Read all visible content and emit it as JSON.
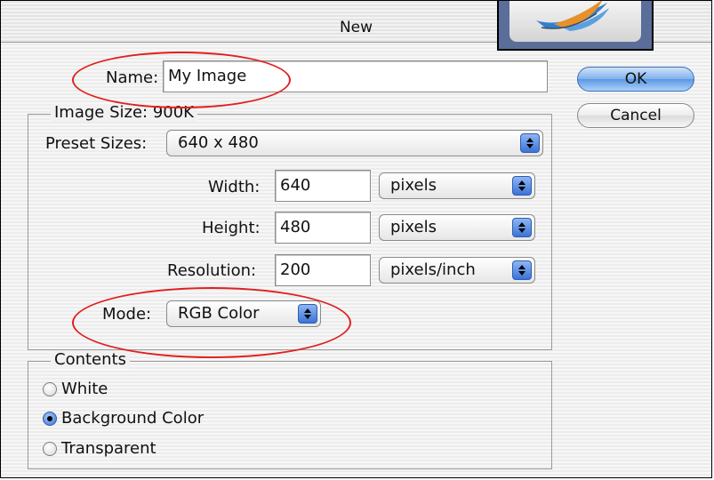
{
  "window": {
    "title": "New"
  },
  "name_field": {
    "label": "Name:",
    "value": "My Image"
  },
  "image_size": {
    "legend": "Image Size: 900K"
  },
  "preset_sizes": {
    "label": "Preset Sizes:",
    "value": "640 x 480"
  },
  "width": {
    "label": "Width:",
    "value": "640",
    "unit": "pixels"
  },
  "height": {
    "label": "Height:",
    "value": "480",
    "unit": "pixels"
  },
  "resolution": {
    "label": "Resolution:",
    "value": "200",
    "unit": "pixels/inch"
  },
  "mode": {
    "label": "Mode:",
    "value": "RGB Color"
  },
  "contents": {
    "legend": "Contents",
    "options": [
      {
        "label": "White",
        "selected": false
      },
      {
        "label": "Background Color",
        "selected": true
      },
      {
        "label": "Transparent",
        "selected": false
      }
    ]
  },
  "buttons": {
    "ok": "OK",
    "cancel": "Cancel"
  },
  "icons": {
    "app": "feather-app-icon",
    "popup": "up-down-arrows-icon",
    "radio": "radio-button-icon"
  },
  "colors": {
    "accent": "#3b73d6",
    "highlight_oval": "#e02020"
  }
}
